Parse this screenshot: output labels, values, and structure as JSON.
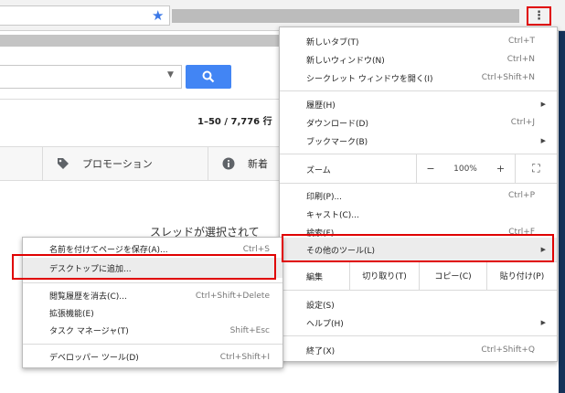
{
  "colors": {
    "accent_blue": "#4285f4",
    "highlight_red": "#e00000",
    "star_blue": "#3b78e7"
  },
  "toolbar": {
    "star_icon": "star-icon",
    "menu_icon": "three-dot-vertical-icon",
    "menu_glyph": "⋮"
  },
  "mail": {
    "count_text": "1–50 / 7,776 行",
    "tabs": {
      "promotions_label": "プロモーション",
      "updates_label": "新着"
    },
    "thread_message": "スレッドが選択されて"
  },
  "menu": {
    "new_tab": {
      "label": "新しいタブ(T)",
      "shortcut": "Ctrl+T"
    },
    "new_window": {
      "label": "新しいウィンドウ(N)",
      "shortcut": "Ctrl+N"
    },
    "incognito": {
      "label": "シークレット ウィンドウを開く(I)",
      "shortcut": "Ctrl+Shift+N"
    },
    "history": {
      "label": "履歴(H)",
      "arrow": "▶"
    },
    "downloads": {
      "label": "ダウンロード(D)",
      "shortcut": "Ctrl+J"
    },
    "bookmarks": {
      "label": "ブックマーク(B)",
      "arrow": "▶"
    },
    "zoom": {
      "label": "ズーム",
      "minus": "−",
      "level": "100%",
      "plus": "+",
      "fullscreen": "⛶"
    },
    "print": {
      "label": "印刷(P)...",
      "shortcut": "Ctrl+P"
    },
    "cast": {
      "label": "キャスト(C)..."
    },
    "find": {
      "label": "検索(F)...",
      "shortcut": "Ctrl+F"
    },
    "more_tools": {
      "label": "その他のツール(L)",
      "arrow": "▶"
    },
    "edit": {
      "label": "編集",
      "cut": "切り取り(T)",
      "copy": "コピー(C)",
      "paste": "貼り付け(P)"
    },
    "settings": {
      "label": "設定(S)"
    },
    "help": {
      "label": "ヘルプ(H)",
      "arrow": "▶"
    },
    "exit": {
      "label": "終了(X)",
      "shortcut": "Ctrl+Shift+Q"
    }
  },
  "submenu": {
    "save_page": {
      "label": "名前を付けてページを保存(A)...",
      "shortcut": "Ctrl+S"
    },
    "add_to_desktop": {
      "label": "デスクトップに追加..."
    },
    "clear_browsing": {
      "label": "閲覧履歴を消去(C)...",
      "shortcut": "Ctrl+Shift+Delete"
    },
    "extensions": {
      "label": "拡張機能(E)"
    },
    "task_manager": {
      "label": "タスク マネージャ(T)",
      "shortcut": "Shift+Esc"
    },
    "developer_tools": {
      "label": "デベロッパー ツール(D)",
      "shortcut": "Ctrl+Shift+I"
    }
  }
}
